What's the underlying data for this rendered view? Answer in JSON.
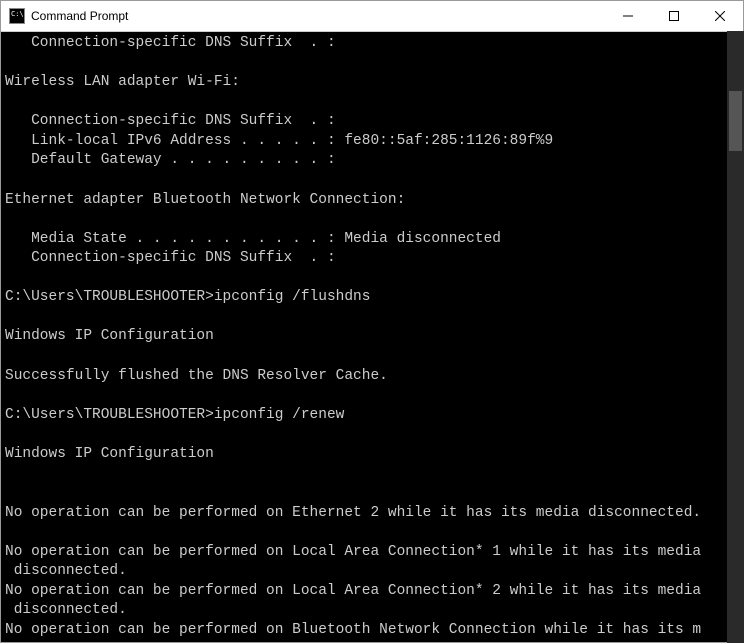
{
  "window": {
    "title": "Command Prompt"
  },
  "console": {
    "lines": [
      "   Connection-specific DNS Suffix  . :",
      "",
      "Wireless LAN adapter Wi-Fi:",
      "",
      "   Connection-specific DNS Suffix  . :",
      "   Link-local IPv6 Address . . . . . : fe80::5af:285:1126:89f%9",
      "   Default Gateway . . . . . . . . . :",
      "",
      "Ethernet adapter Bluetooth Network Connection:",
      "",
      "   Media State . . . . . . . . . . . : Media disconnected",
      "   Connection-specific DNS Suffix  . :",
      "",
      "C:\\Users\\TROUBLESHOOTER>ipconfig /flushdns",
      "",
      "Windows IP Configuration",
      "",
      "Successfully flushed the DNS Resolver Cache.",
      "",
      "C:\\Users\\TROUBLESHOOTER>ipconfig /renew",
      "",
      "Windows IP Configuration",
      "",
      "",
      "No operation can be performed on Ethernet 2 while it has its media disconnected.",
      "",
      "No operation can be performed on Local Area Connection* 1 while it has its media",
      " disconnected.",
      "No operation can be performed on Local Area Connection* 2 while it has its media",
      " disconnected.",
      "No operation can be performed on Bluetooth Network Connection while it has its m"
    ]
  }
}
